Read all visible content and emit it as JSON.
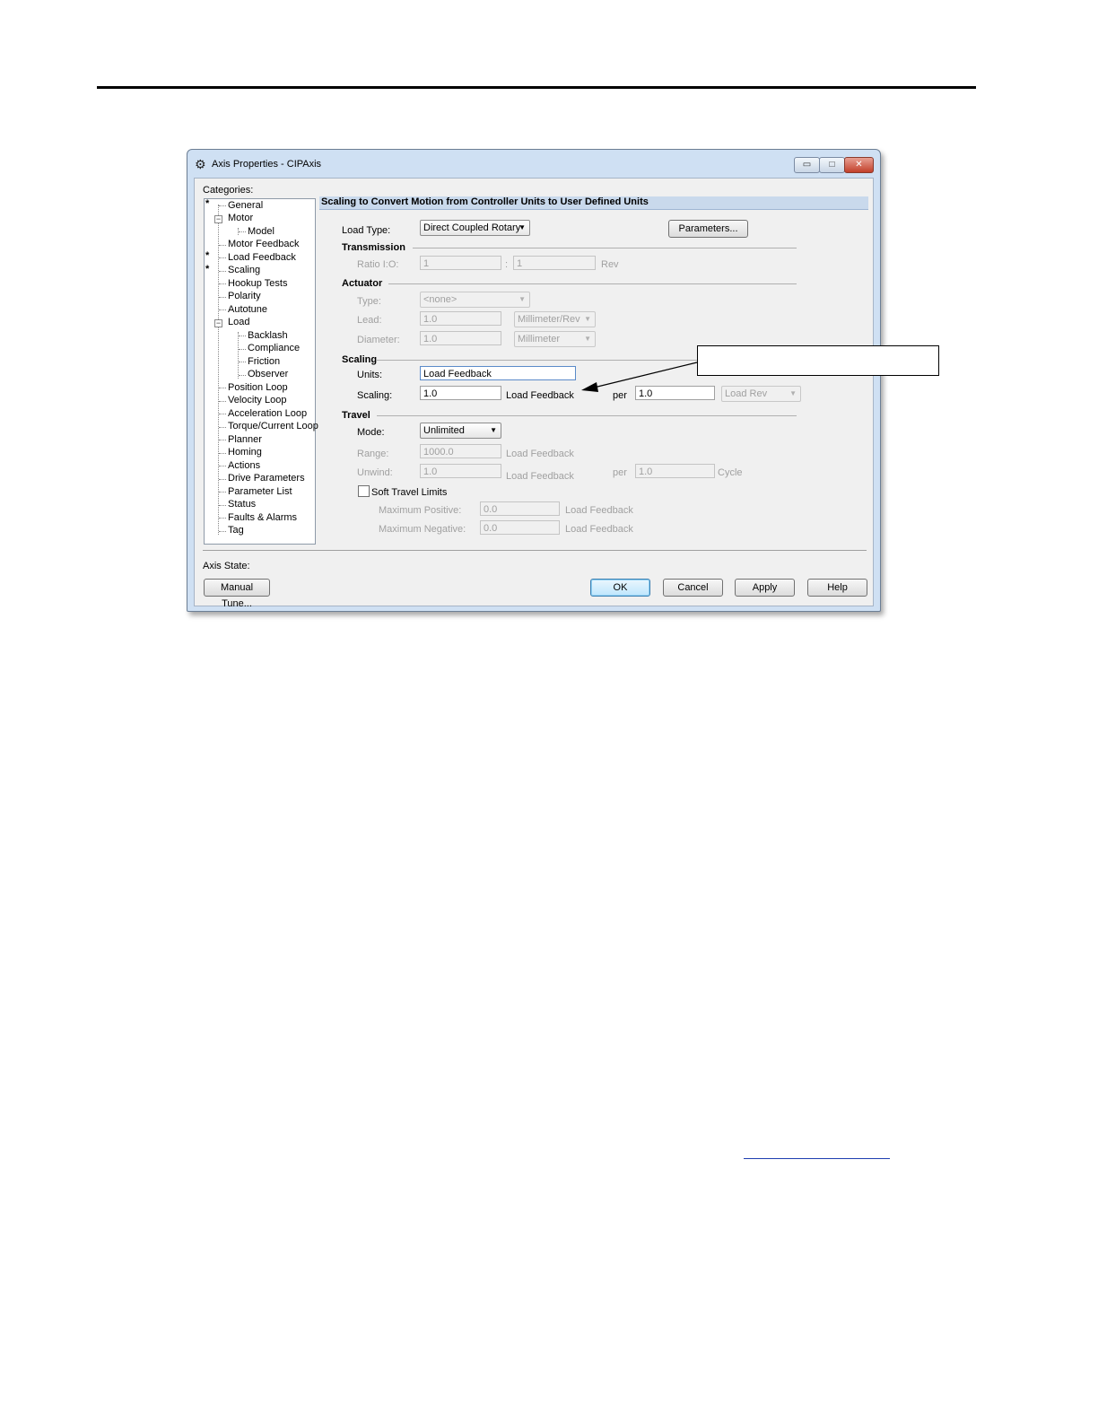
{
  "window": {
    "title": "Axis Properties - CIPAxis",
    "title_icon": "gear-icon",
    "controls": {
      "minimize": "▭",
      "maximize": "□",
      "close": "✕"
    }
  },
  "categories": {
    "label": "Categories:",
    "items": [
      "General",
      "Motor",
      "Model",
      "Motor Feedback",
      "Load Feedback",
      "Scaling",
      "Hookup Tests",
      "Polarity",
      "Autotune",
      "Load",
      "Backlash",
      "Compliance",
      "Friction",
      "Observer",
      "Position Loop",
      "Velocity Loop",
      "Acceleration Loop",
      "Torque/Current Loop",
      "Planner",
      "Homing",
      "Actions",
      "Drive Parameters",
      "Parameter List",
      "Status",
      "Faults & Alarms",
      "Tag"
    ],
    "star": "*",
    "expander": "−"
  },
  "panel": {
    "header": "Scaling to Convert Motion from Controller Units to User Defined Units",
    "load_type_label": "Load Type:",
    "load_type_value": "Direct Coupled Rotary",
    "parameters_button": "Parameters...",
    "transmission": {
      "title": "Transmission",
      "ratio_label": "Ratio I:O:",
      "ratio_input": "1",
      "ratio_output": "1",
      "colon": ":",
      "unit": "Rev"
    },
    "actuator": {
      "title": "Actuator",
      "type_label": "Type:",
      "type_value": "<none>",
      "lead_label": "Lead:",
      "lead_value": "1.0",
      "lead_unit": "Millimeter/Rev",
      "diameter_label": "Diameter:",
      "diameter_value": "1.0",
      "diameter_unit": "Millimeter"
    },
    "scaling": {
      "title": "Scaling",
      "units_label": "Units:",
      "units_value": "Load Feedback",
      "scaling_label": "Scaling:",
      "scaling_value": "1.0",
      "scaling_unit": "Load Feedback",
      "per_label": "per",
      "per_value": "1.0",
      "per_unit": "Load Rev"
    },
    "travel": {
      "title": "Travel",
      "mode_label": "Mode:",
      "mode_value": "Unlimited",
      "range_label": "Range:",
      "range_value": "1000.0",
      "range_unit": "Load Feedback",
      "unwind_label": "Unwind:",
      "unwind_value": "1.0",
      "unwind_unit": "Load Feedback",
      "unwind_per_label": "per",
      "unwind_per_value": "1.0",
      "unwind_per_unit": "Cycle",
      "soft_limits_label": "Soft Travel Limits",
      "soft_limits_checked": false,
      "max_pos_label": "Maximum Positive:",
      "max_pos_value": "0.0",
      "max_pos_unit": "Load Feedback",
      "max_neg_label": "Maximum Negative:",
      "max_neg_value": "0.0",
      "max_neg_unit": "Load Feedback"
    }
  },
  "footer": {
    "axis_state_label": "Axis State:",
    "manual_tune_button": "Manual Tune...",
    "ok_button": "OK",
    "cancel_button": "Cancel",
    "apply_button": "Apply",
    "help_button": "Help"
  },
  "icons": {
    "dropdown": "▼",
    "gear": "⚙"
  }
}
